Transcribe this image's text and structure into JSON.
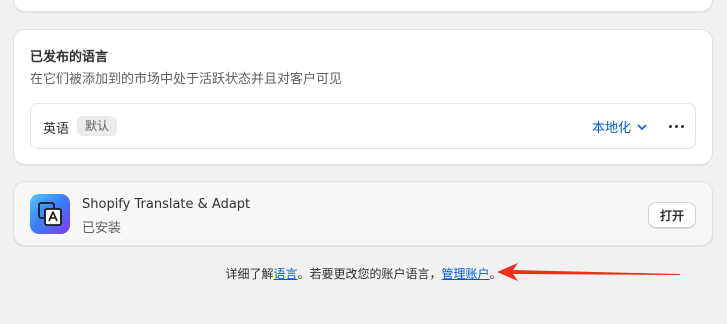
{
  "published": {
    "title": "已发布的语言",
    "subtitle": "在它们被添加到的市场中处于活跃状态并且对客户可见",
    "language": {
      "name": "英语",
      "badge": "默认",
      "localize_label": "本地化"
    }
  },
  "app": {
    "name": "Shopify Translate & Adapt",
    "status": "已安装",
    "open_label": "打开",
    "icon": "translate-app-icon"
  },
  "footer": {
    "prefix": "详细了解",
    "link1": "语言",
    "middle": "。若要更改您的账户语言，",
    "link2": "管理账户",
    "suffix": "。"
  },
  "colors": {
    "link": "#005bd3",
    "background": "#f1f1f1",
    "annotation_arrow": "#e8321f"
  }
}
